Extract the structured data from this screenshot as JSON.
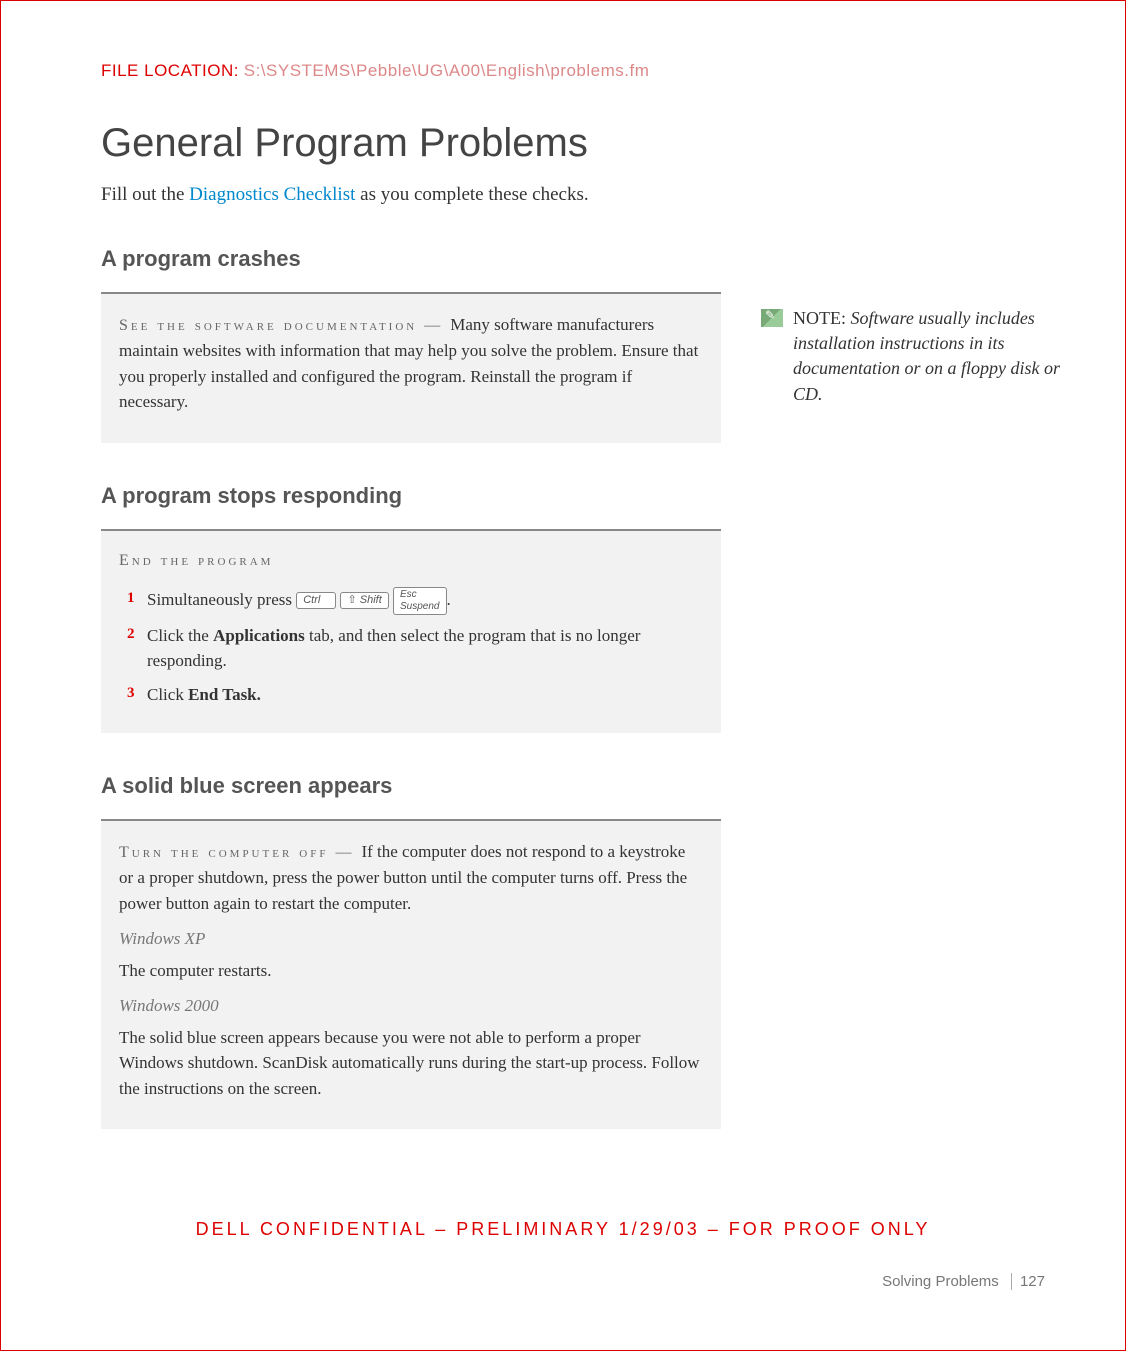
{
  "file_location": {
    "label": "FILE LOCATION:",
    "path": "S:\\SYSTEMS\\Pebble\\UG\\A00\\English\\problems.fm"
  },
  "title": "General Program Problems",
  "intro_pre": "Fill out the ",
  "intro_link": "Diagnostics Checklist",
  "intro_post": " as you complete these checks.",
  "crashes": {
    "heading": "A program crashes",
    "lead": "See the software documentation — ",
    "body": "Many software manufacturers maintain websites with information that may help you solve the problem. Ensure that you properly installed and configured the program. Reinstall the program if necessary."
  },
  "note": {
    "label": "NOTE:",
    "body": " Software usually includes installation instructions in its documentation or on a floppy disk or CD."
  },
  "stops": {
    "heading": "A program stops responding",
    "lead": "End the program",
    "step1_pre": "Simultaneously press ",
    "key_ctrl": "Ctrl",
    "key_shift": "Shift",
    "key_esc_top": "Esc",
    "key_esc_bot": "Suspend",
    "step1_post": ".",
    "step2_pre": "Click the ",
    "step2_bold": "Applications",
    "step2_post": " tab, and then select the program that is no longer responding.",
    "step3_pre": " Click ",
    "step3_bold": "End Task."
  },
  "blue": {
    "heading": "A solid blue screen appears",
    "lead": "Turn the computer off — ",
    "body": "If the computer does not respond to a keystroke or a proper shutdown, press the power button until the computer turns off. Press the power button again to restart the computer.",
    "os1": "Windows XP",
    "os1_body": "The computer restarts.",
    "os2": "Windows 2000",
    "os2_body": "The solid blue screen appears because you were not able to perform a proper Windows shutdown. ScanDisk automatically runs during the start-up process. Follow the instructions on the screen."
  },
  "confidential": "DELL CONFIDENTIAL – PRELIMINARY 1/29/03 – FOR PROOF ONLY",
  "footer": {
    "section": "Solving Problems",
    "page": "127"
  }
}
